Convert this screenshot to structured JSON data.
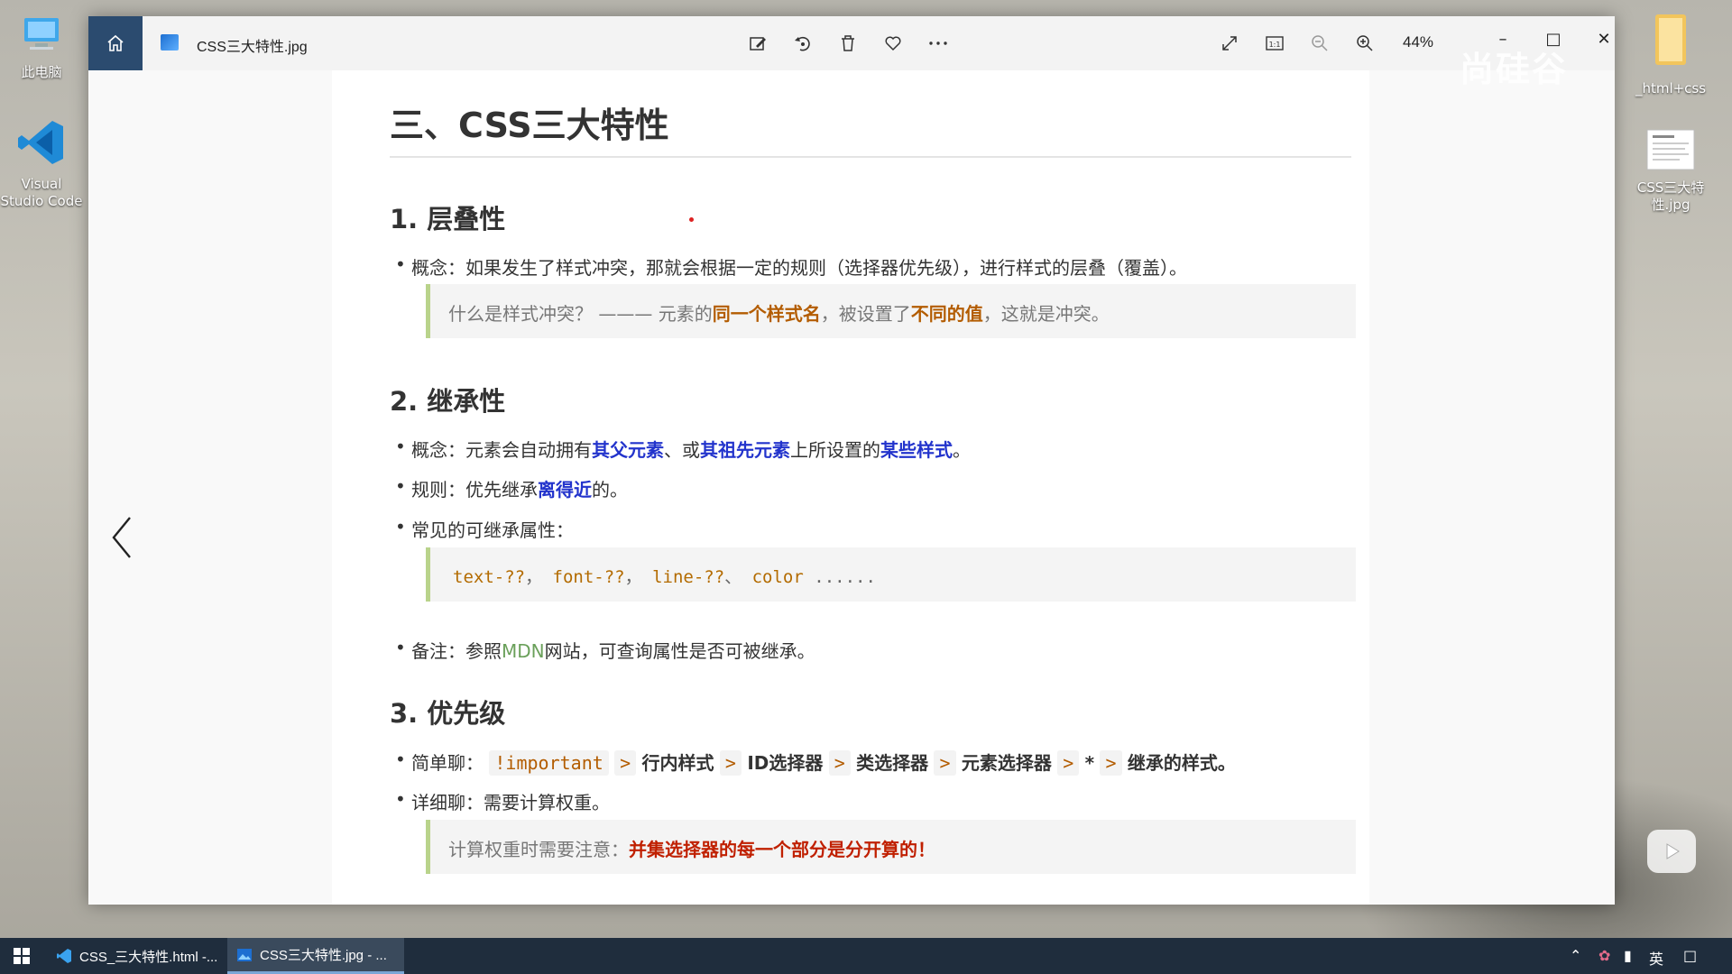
{
  "desktop": {
    "icons": [
      {
        "label": "此电脑",
        "icon": "computer-icon"
      },
      {
        "label": "Visual Studio Code",
        "icon": "vscode-icon"
      },
      {
        "label": "_html+css",
        "icon": "folder-icon"
      },
      {
        "label": "CSS三大特性.jpg",
        "icon": "image-file-icon"
      }
    ]
  },
  "window": {
    "file_name": "CSS三大特性.jpg",
    "zoom": "44%",
    "watermark": "尚硅谷"
  },
  "doc": {
    "title": "三、CSS三大特性",
    "s1": {
      "heading": "1. 层叠性",
      "concept_label": "概念：",
      "concept_text": "如果发生了样式冲突，那就会根据一定的规则（选择器优先级），进行样式的层叠（覆盖）。",
      "quote_a": "什么是样式冲突？   ———   元素的",
      "quote_hl1": "同一个样式名",
      "quote_b": "，被设置了",
      "quote_hl2": "不同的值",
      "quote_c": "，这就是冲突。"
    },
    "s2": {
      "heading": "2. 继承性",
      "c_label": "概念：",
      "c_a": "元素会自动拥有",
      "c_hl1": "其父元素",
      "c_b": "、或",
      "c_hl2": "其祖先元素",
      "c_c": "上所设置的",
      "c_hl3": "某些样式",
      "c_d": "。",
      "r_label": "规则：",
      "r_a": "优先继承",
      "r_hl": "离得近",
      "r_b": "的。",
      "common": "常见的可继承属性：",
      "code1": "text-??",
      "code2": "font-??",
      "code3": "line-??",
      "code4": "color",
      "code_more": "......",
      "note_label": "备注：",
      "note_a": "参照",
      "note_mdn": "MDN",
      "note_b": "网站，可查询属性是否可被继承。"
    },
    "s3": {
      "heading": "3. 优先级",
      "simple_label": "简单聊：",
      "p1": "!important",
      "p2": "行内样式",
      "p3": "ID选择器",
      "p4": "类选择器",
      "p5": "元素选择器",
      "p6": "*",
      "p7": "继承的样式。",
      "gt": ">",
      "detail_label": "详细聊：",
      "detail_text": "需要计算权重。",
      "quote_a": "计算权重时需要注意：",
      "quote_hl": "并集选择器的每一个部分是分开算的！"
    }
  },
  "taskbar": {
    "items": [
      {
        "label": "CSS_三大特性.html -...",
        "icon": "vscode-icon"
      },
      {
        "label": "CSS三大特性.jpg - ...",
        "icon": "photos-icon"
      }
    ],
    "ime": "英"
  }
}
